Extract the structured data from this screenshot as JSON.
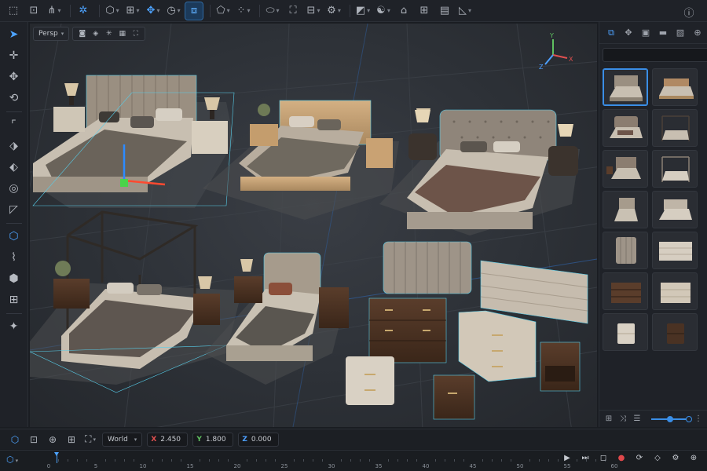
{
  "toolbar": {
    "icons": [
      "select-icon",
      "frame-icon",
      "snap-icon",
      "cube-icon",
      "transform-icon",
      "move-icon",
      "rotate-icon",
      "view-icon",
      "primitive-icon",
      "region-icon",
      "grid-icon",
      "settings-icon",
      "render-icon",
      "camera-icon",
      "home-icon",
      "table-icon",
      "panel-icon",
      "edit-icon",
      "info-icon"
    ]
  },
  "viewport": {
    "camera_label": "Persp"
  },
  "gizmo": {
    "x": "X",
    "y": "Y",
    "z": "Z"
  },
  "assets": {
    "search_placeholder": "",
    "thumbnails": [
      "bed-upholstered",
      "bed-wood-low",
      "bed-tufted",
      "bed-canopy",
      "bed-panel",
      "bed-canopy-light",
      "bed-single",
      "bed-queen",
      "headboard-tall",
      "headboard-low",
      "dresser-dark",
      "dresser-light",
      "nightstand-light",
      "nightstand-dark"
    ]
  },
  "transform": {
    "space": "World",
    "x_label": "X",
    "x_value": "2.450",
    "y_label": "Y",
    "y_value": "1.800",
    "z_label": "Z",
    "z_value": "0.000"
  },
  "timeline": {
    "ticks": [
      "0",
      "5",
      "10",
      "15",
      "20",
      "25",
      "30",
      "35",
      "40",
      "45",
      "50",
      "55",
      "60"
    ],
    "current_frame": 0
  },
  "colors": {
    "accent": "#4da3ff",
    "axis_x": "#e05050",
    "axis_y": "#5fc060",
    "axis_z": "#4d9fff",
    "record": "#e0484b"
  }
}
